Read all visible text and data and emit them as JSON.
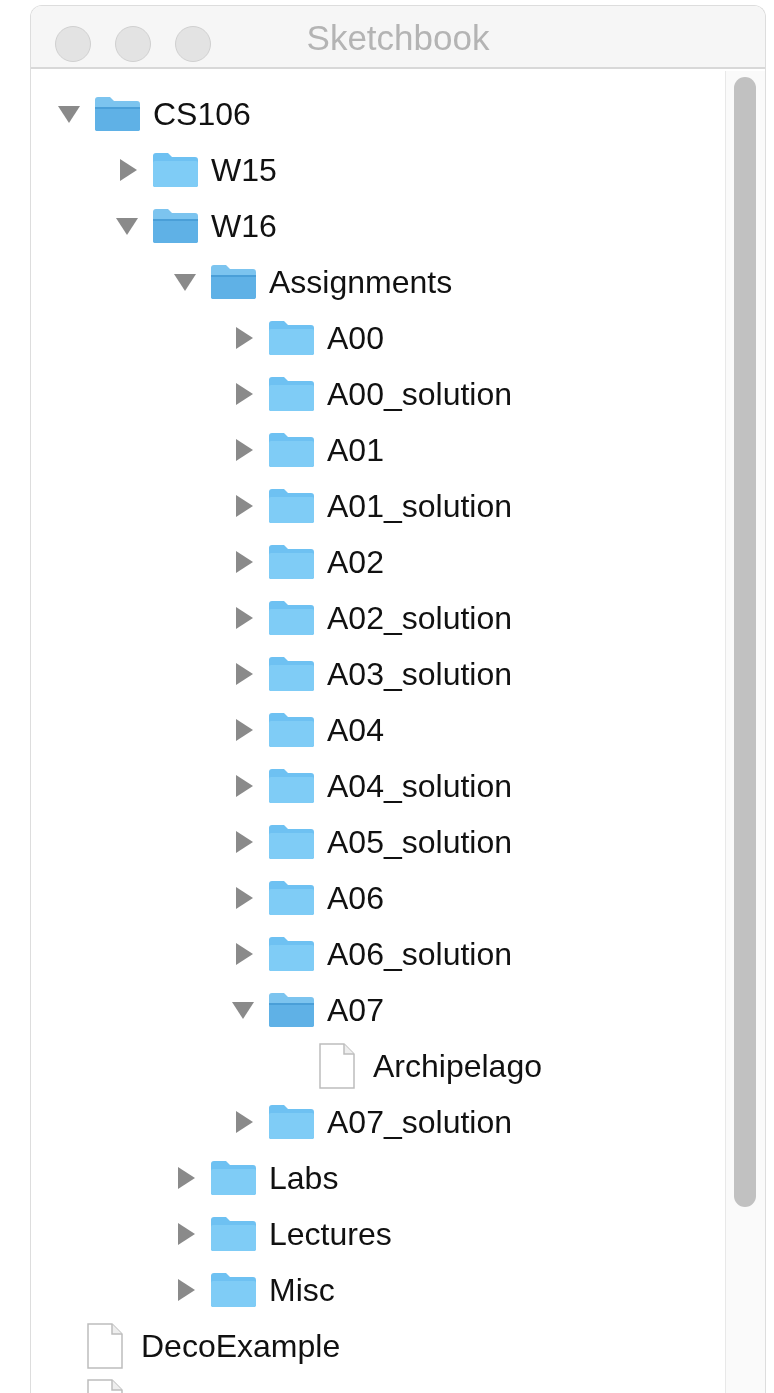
{
  "window": {
    "title": "Sketchbook"
  },
  "tree": [
    {
      "kind": "folder",
      "label": "CS106",
      "expanded": true,
      "children": [
        {
          "kind": "folder",
          "label": "W15",
          "expanded": false
        },
        {
          "kind": "folder",
          "label": "W16",
          "expanded": true,
          "children": [
            {
              "kind": "folder",
              "label": "Assignments",
              "expanded": true,
              "children": [
                {
                  "kind": "folder",
                  "label": "A00",
                  "expanded": false
                },
                {
                  "kind": "folder",
                  "label": "A00_solution",
                  "expanded": false
                },
                {
                  "kind": "folder",
                  "label": "A01",
                  "expanded": false
                },
                {
                  "kind": "folder",
                  "label": "A01_solution",
                  "expanded": false
                },
                {
                  "kind": "folder",
                  "label": "A02",
                  "expanded": false
                },
                {
                  "kind": "folder",
                  "label": "A02_solution",
                  "expanded": false
                },
                {
                  "kind": "folder",
                  "label": "A03_solution",
                  "expanded": false
                },
                {
                  "kind": "folder",
                  "label": "A04",
                  "expanded": false
                },
                {
                  "kind": "folder",
                  "label": "A04_solution",
                  "expanded": false
                },
                {
                  "kind": "folder",
                  "label": "A05_solution",
                  "expanded": false
                },
                {
                  "kind": "folder",
                  "label": "A06",
                  "expanded": false
                },
                {
                  "kind": "folder",
                  "label": "A06_solution",
                  "expanded": false
                },
                {
                  "kind": "folder",
                  "label": "A07",
                  "expanded": true,
                  "children": [
                    {
                      "kind": "file",
                      "label": "Archipelago"
                    }
                  ]
                },
                {
                  "kind": "folder",
                  "label": "A07_solution",
                  "expanded": false
                }
              ]
            },
            {
              "kind": "folder",
              "label": "Labs",
              "expanded": false
            },
            {
              "kind": "folder",
              "label": "Lectures",
              "expanded": false
            },
            {
              "kind": "folder",
              "label": "Misc",
              "expanded": false
            }
          ]
        }
      ]
    },
    {
      "kind": "file",
      "label": "DecoExample"
    },
    {
      "kind": "file"
    }
  ]
}
